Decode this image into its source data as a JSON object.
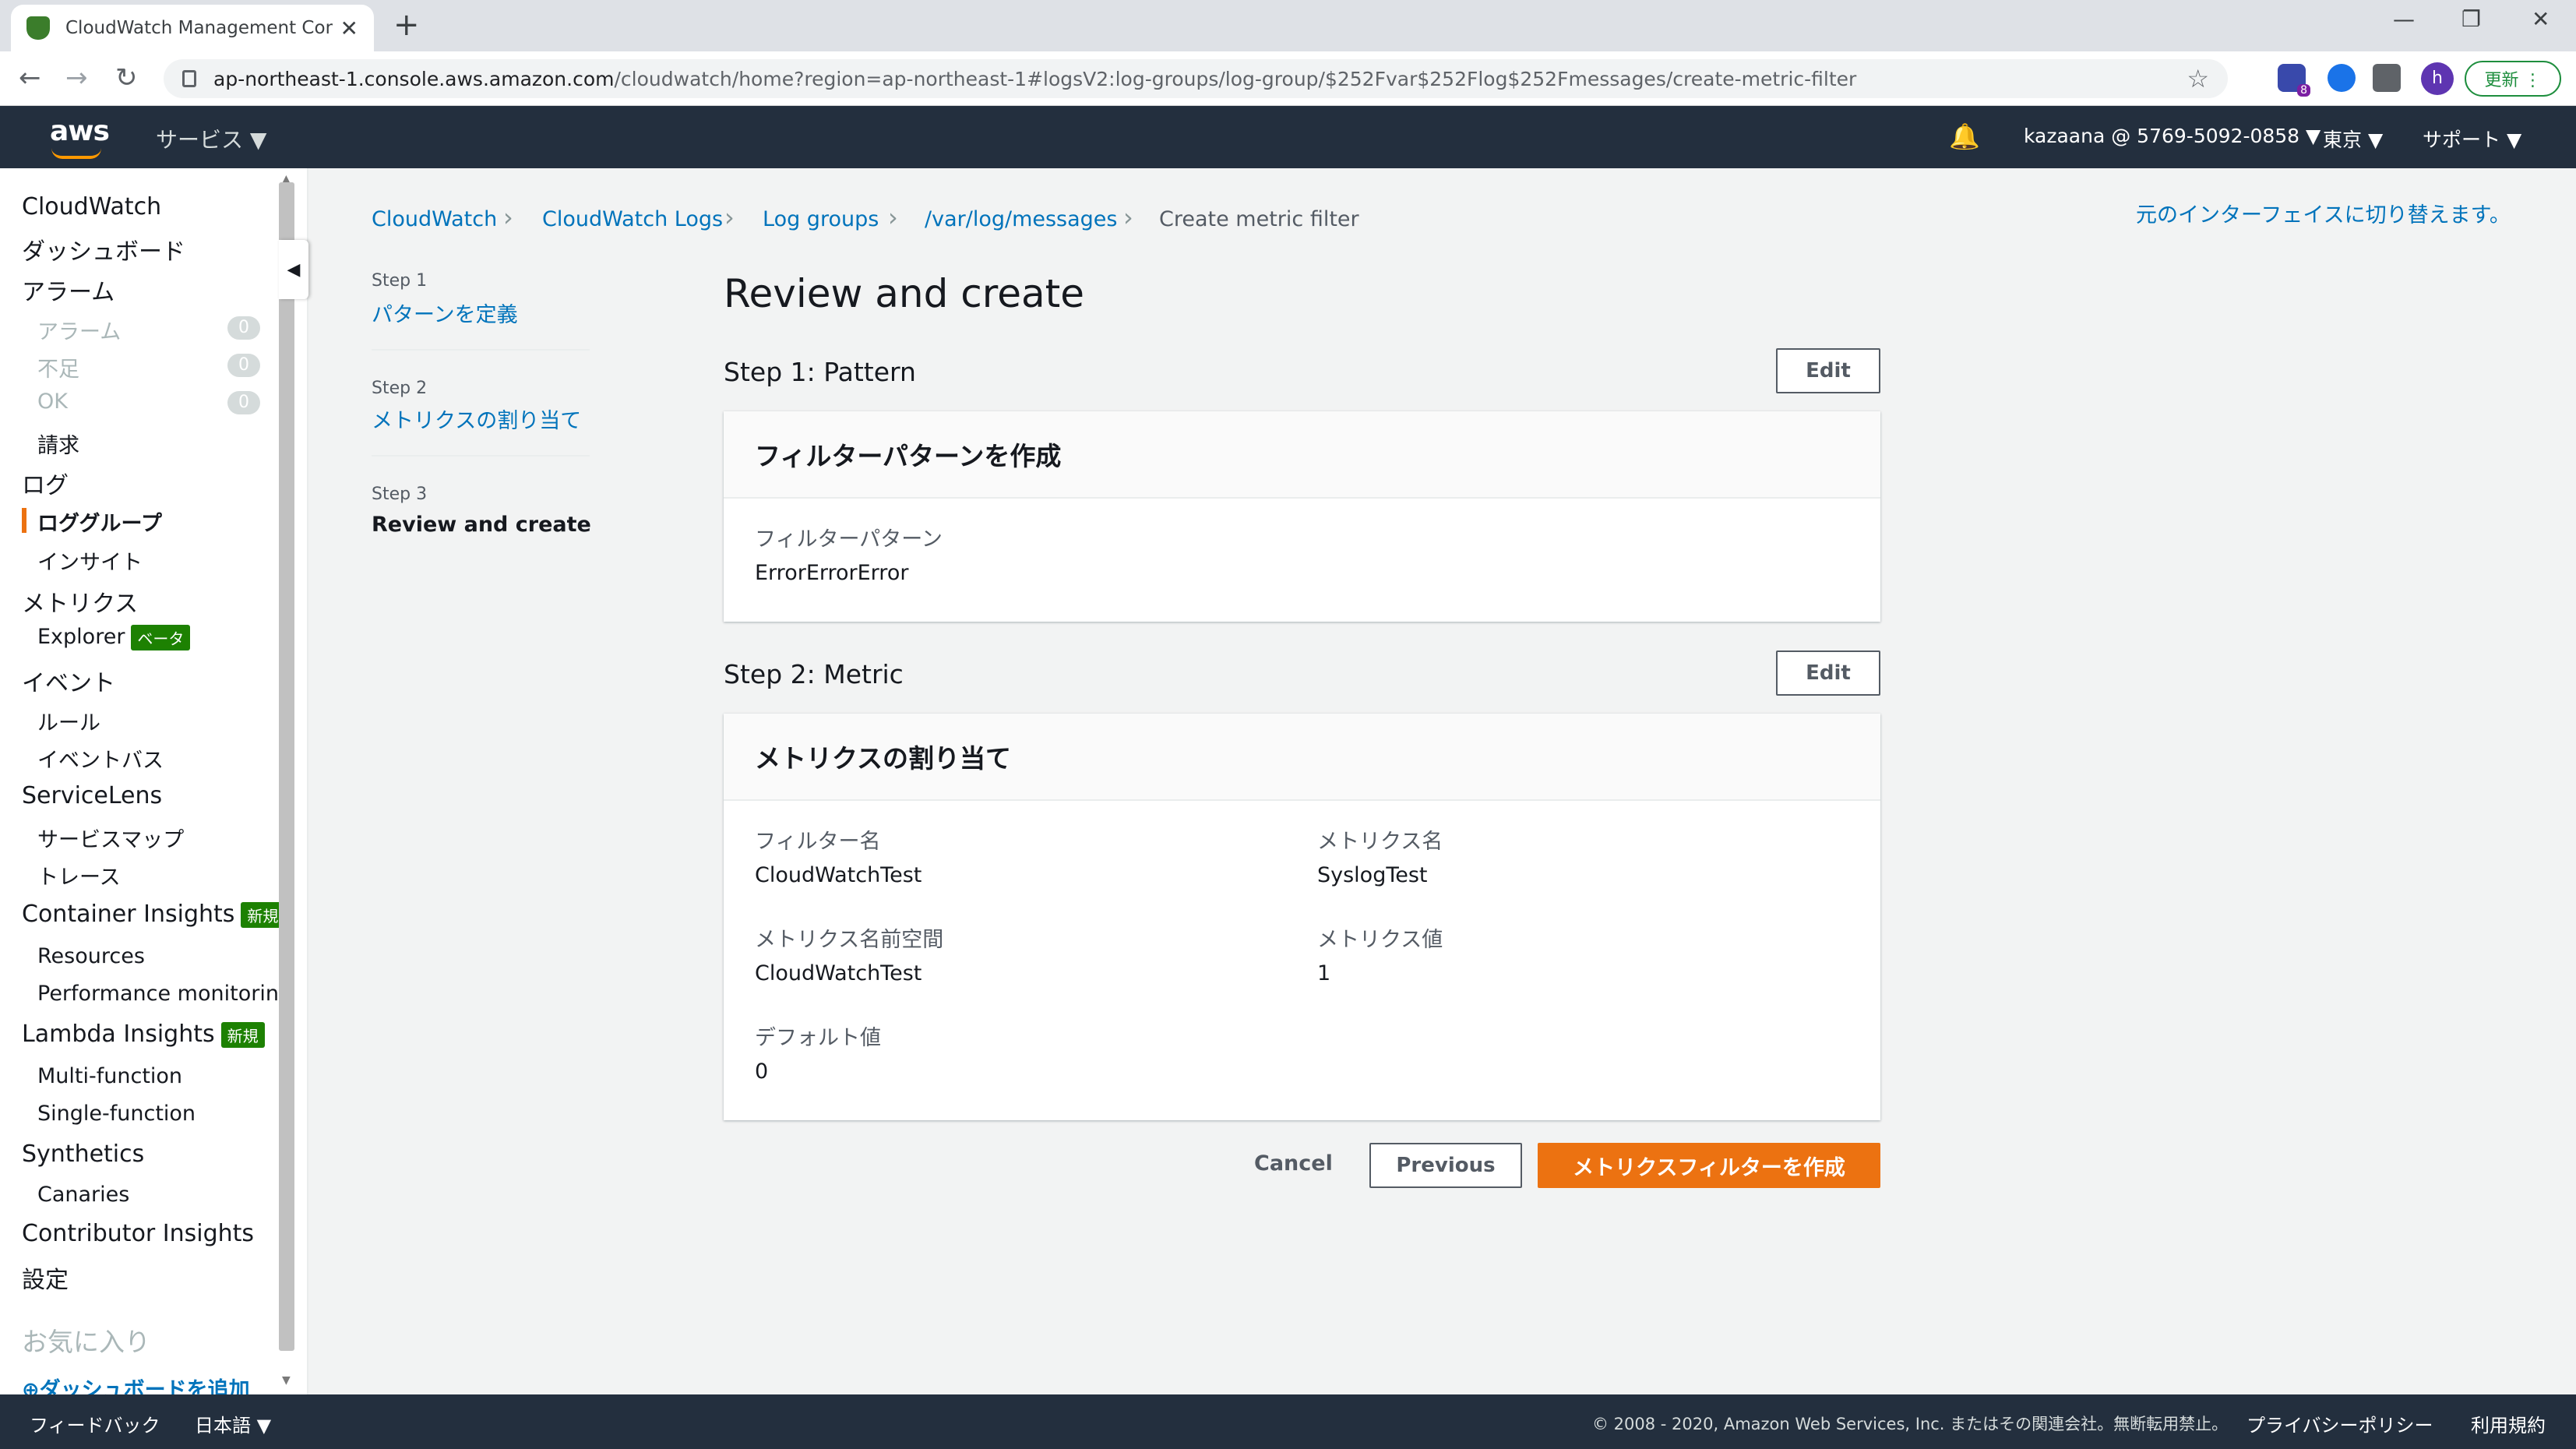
{
  "browser": {
    "tab_title": "CloudWatch Management Conso",
    "close": "✕",
    "new_tab": "+",
    "minimize": "—",
    "restore": "❐",
    "close_window": "✕",
    "back": "←",
    "forward": "→",
    "reload": "↻",
    "url_host": "ap-northeast-1.console.aws.amazon.com",
    "url_path": "/cloudwatch/home?region=ap-northeast-1#logsV2:log-groups/log-group/$252Fvar$252Flog$252Fmessages/create-metric-filter",
    "star": "☆",
    "ext_badge": "8",
    "avatar": "h",
    "update": "更新 ⋮"
  },
  "aws_header": {
    "logo": "aws",
    "services": "サービス ▼",
    "bell": "🔔",
    "account": "kazaana @ 5769-5092-0858 ▼",
    "region": "東京 ▼",
    "support": "サポート ▼"
  },
  "sidebar": {
    "cloudwatch": "CloudWatch",
    "dashboard": "ダッシュボード",
    "alarms": "アラーム",
    "alarm_sub": "アラーム",
    "alarm_count": "0",
    "insufficient": "不足",
    "insufficient_count": "0",
    "ok": "OK",
    "ok_count": "0",
    "billing": "請求",
    "logs": "ログ",
    "log_groups": "ロググループ",
    "insights": "インサイト",
    "metrics": "メトリクス",
    "explorer": "Explorer",
    "beta": "ベータ",
    "events": "イベント",
    "rules": "ルール",
    "event_bus": "イベントバス",
    "servicelens": "ServiceLens",
    "service_map": "サービスマップ",
    "traces": "トレース",
    "container_insights": "Container Insights",
    "new1": "新規",
    "resources": "Resources",
    "perf_monitoring": "Performance monitoring",
    "lambda_insights": "Lambda Insights",
    "new2": "新規",
    "multi_function": "Multi-function",
    "single_function": "Single-function",
    "synthetics": "Synthetics",
    "canaries": "Canaries",
    "contributor_insights": "Contributor Insights",
    "settings": "設定",
    "favorites": "お気に入り",
    "add_dashboard": "⊕ダッシュボードを追加"
  },
  "breadcrumb": {
    "items": [
      "CloudWatch",
      "CloudWatch Logs",
      "Log groups",
      "/var/log/messages",
      "Create metric filter"
    ],
    "sep": "›"
  },
  "switch_interface": "元のインターフェイスに切り替えます。",
  "steps": [
    {
      "label": "Step 1",
      "name": "パターンを定義"
    },
    {
      "label": "Step 2",
      "name": "メトリクスの割り当て"
    },
    {
      "label": "Step 3",
      "name": "Review and create"
    }
  ],
  "main": {
    "title": "Review and create",
    "step1_title": "Step 1: Pattern",
    "step2_title": "Step 2: Metric",
    "edit": "Edit",
    "pattern_panel": {
      "header": "フィルターパターンを作成",
      "key": "フィルターパターン",
      "value": "ErrorErrorError"
    },
    "metric_panel": {
      "header": "メトリクスの割り当て",
      "filter_name_key": "フィルター名",
      "filter_name_val": "CloudWatchTest",
      "metric_name_key": "メトリクス名",
      "metric_name_val": "SyslogTest",
      "namespace_key": "メトリクス名前空間",
      "namespace_val": "CloudWatchTest",
      "metric_value_key": "メトリクス値",
      "metric_value_val": "1",
      "default_key": "デフォルト値",
      "default_val": "0"
    },
    "cancel": "Cancel",
    "previous": "Previous",
    "create": "メトリクスフィルターを作成"
  },
  "footer": {
    "feedback": "フィードバック",
    "language": "日本語 ▼",
    "copyright": "© 2008 - 2020, Amazon Web Services, Inc. またはその関連会社。無断転用禁止。",
    "privacy": "プライバシーポリシー",
    "terms": "利用規約"
  }
}
